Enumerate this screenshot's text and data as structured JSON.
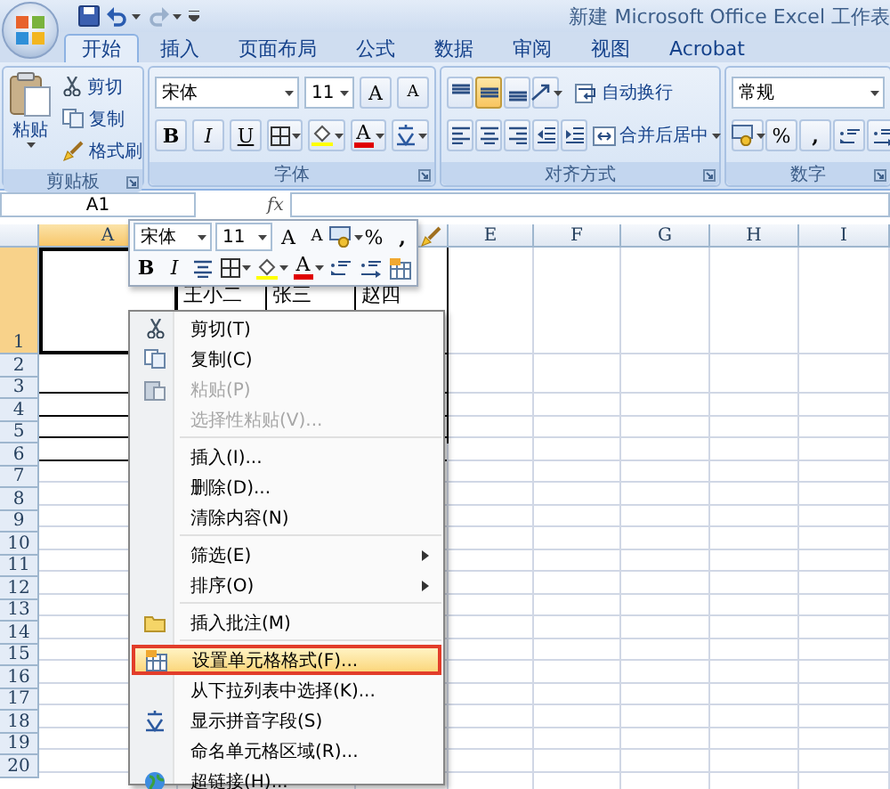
{
  "window": {
    "title": "新建 Microsoft Office Excel 工作表"
  },
  "tabs": [
    {
      "label": "开始",
      "selected": true
    },
    {
      "label": "插入",
      "selected": false
    },
    {
      "label": "页面布局",
      "selected": false
    },
    {
      "label": "公式",
      "selected": false
    },
    {
      "label": "数据",
      "selected": false
    },
    {
      "label": "审阅",
      "selected": false
    },
    {
      "label": "视图",
      "selected": false
    },
    {
      "label": "Acrobat",
      "selected": false
    }
  ],
  "ribbon": {
    "clipboard": {
      "label": "剪贴板",
      "paste": "粘贴",
      "commands": [
        "剪切",
        "复制",
        "格式刷"
      ]
    },
    "font": {
      "label": "字体",
      "name": "宋体",
      "size": "11",
      "grow": "A",
      "shrink": "A",
      "bold": "B",
      "italic": "I",
      "underline": "U",
      "font_color_letter": "A"
    },
    "alignment": {
      "label": "对齐方式",
      "vertical": [
        {
          "selected": false
        },
        {
          "selected": true
        },
        {
          "selected": false
        }
      ],
      "wrap": "自动换行",
      "merge": "合并后居中"
    },
    "number": {
      "label": "数字",
      "format": "常规",
      "percent": "%",
      "comma": ","
    }
  },
  "name_box": "A1",
  "formula_label": "fx",
  "mini_toolbar": {
    "font": "宋体",
    "size": "11",
    "grow": "A",
    "shrink": "A",
    "percent": "%",
    "comma": ",",
    "bold": "B",
    "italic": "I",
    "font_color_letter": "A"
  },
  "columns": [
    {
      "label": "A",
      "selected": true
    },
    {
      "label": "E",
      "selected": false
    },
    {
      "label": "F",
      "selected": false
    },
    {
      "label": "G",
      "selected": false
    },
    {
      "label": "H",
      "selected": false
    },
    {
      "label": "I",
      "selected": false
    }
  ],
  "rows": [
    {
      "label": "1",
      "selected": true,
      "cells": [
        "王小二",
        "张三",
        "赵四"
      ]
    },
    {
      "label": "2",
      "selected": false
    },
    {
      "label": "3",
      "selected": false
    },
    {
      "label": "4",
      "selected": false
    },
    {
      "label": "5",
      "selected": false
    },
    {
      "label": "6",
      "selected": false
    },
    {
      "label": "7",
      "selected": false
    },
    {
      "label": "8",
      "selected": false
    },
    {
      "label": "9",
      "selected": false
    },
    {
      "label": "10",
      "selected": false
    },
    {
      "label": "11",
      "selected": false
    },
    {
      "label": "12",
      "selected": false
    },
    {
      "label": "13",
      "selected": false
    },
    {
      "label": "14",
      "selected": false
    },
    {
      "label": "15",
      "selected": false
    },
    {
      "label": "16",
      "selected": false
    },
    {
      "label": "17",
      "selected": false
    },
    {
      "label": "18",
      "selected": false
    },
    {
      "label": "19",
      "selected": false
    },
    {
      "label": "20",
      "selected": false
    }
  ],
  "context_menu": {
    "items": [
      {
        "kind": "item",
        "label": "剪切(T)",
        "disabled": false,
        "highlighted": false,
        "submenu": false
      },
      {
        "kind": "item",
        "label": "复制(C)",
        "disabled": false,
        "highlighted": false,
        "submenu": false
      },
      {
        "kind": "item",
        "label": "粘贴(P)",
        "disabled": true,
        "highlighted": false,
        "submenu": false
      },
      {
        "kind": "item",
        "label": "选择性粘贴(V)...",
        "disabled": true,
        "highlighted": false,
        "submenu": false
      },
      {
        "kind": "separator"
      },
      {
        "kind": "item",
        "label": "插入(I)...",
        "disabled": false,
        "highlighted": false,
        "submenu": false
      },
      {
        "kind": "item",
        "label": "删除(D)...",
        "disabled": false,
        "highlighted": false,
        "submenu": false
      },
      {
        "kind": "item",
        "label": "清除内容(N)",
        "disabled": false,
        "highlighted": false,
        "submenu": false
      },
      {
        "kind": "separator"
      },
      {
        "kind": "item",
        "label": "筛选(E)",
        "disabled": false,
        "highlighted": false,
        "submenu": true
      },
      {
        "kind": "item",
        "label": "排序(O)",
        "disabled": false,
        "highlighted": false,
        "submenu": true
      },
      {
        "kind": "separator"
      },
      {
        "kind": "item",
        "label": "插入批注(M)",
        "disabled": false,
        "highlighted": false,
        "submenu": false
      },
      {
        "kind": "separator"
      },
      {
        "kind": "item",
        "label": "设置单元格格式(F)...",
        "disabled": false,
        "highlighted": true,
        "submenu": false
      },
      {
        "kind": "item",
        "label": "从下拉列表中选择(K)...",
        "disabled": false,
        "highlighted": false,
        "submenu": false
      },
      {
        "kind": "item",
        "label": "显示拼音字段(S)",
        "disabled": false,
        "highlighted": false,
        "submenu": false
      },
      {
        "kind": "item",
        "label": "命名单元格区域(R)...",
        "disabled": false,
        "highlighted": false,
        "submenu": false
      },
      {
        "kind": "item",
        "label": "超链接(H)...",
        "disabled": false,
        "highlighted": false,
        "submenu": false
      }
    ]
  }
}
